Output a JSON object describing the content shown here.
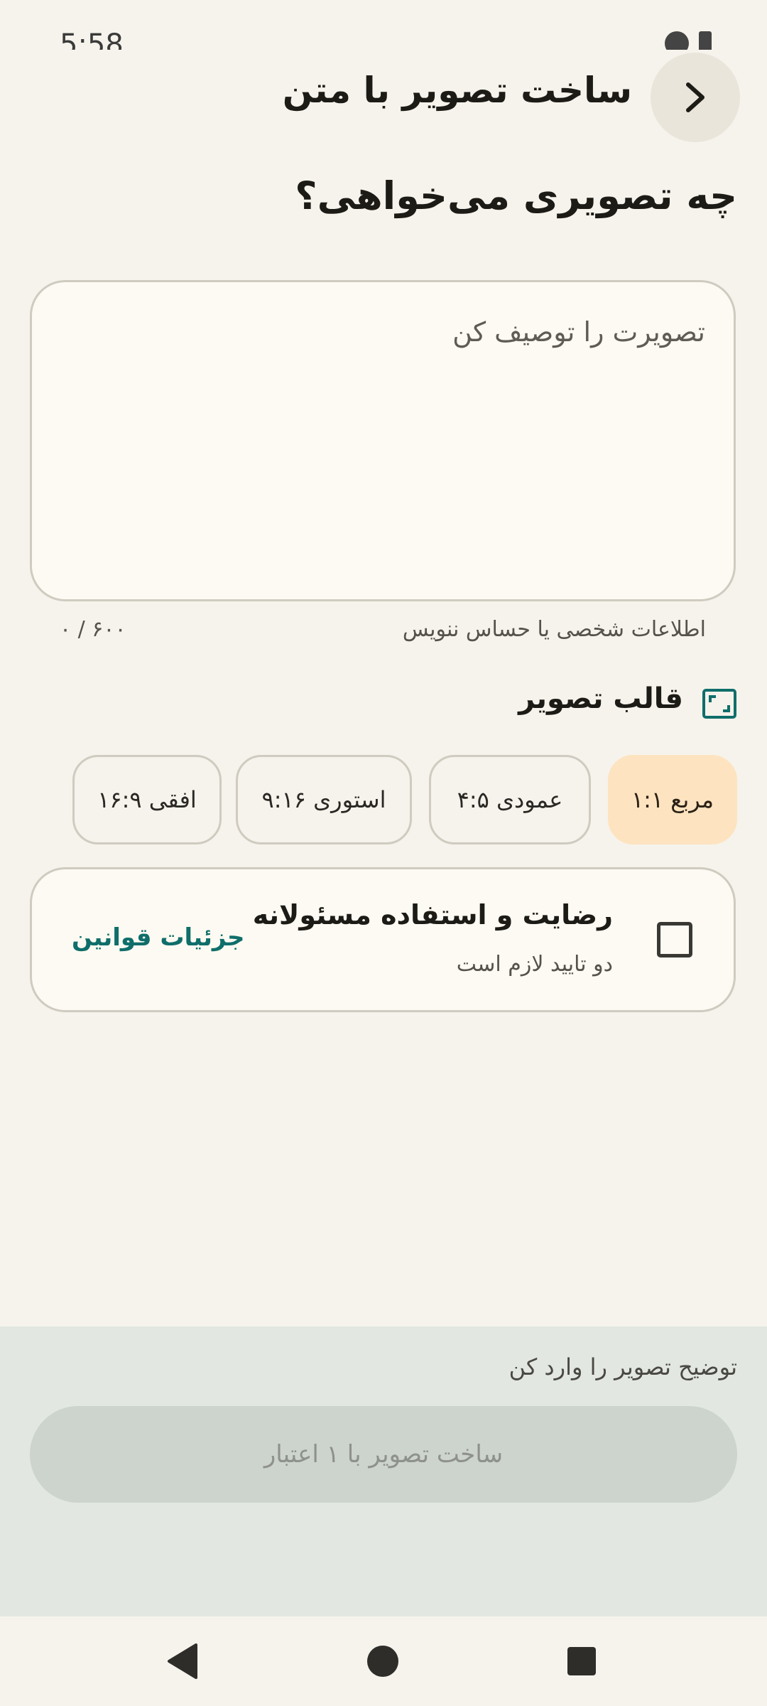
{
  "status_bar": {
    "time": "5:58"
  },
  "header": {
    "title": "ساخت تصویر با متن"
  },
  "question": "چه تصویری می‌خواهی؟",
  "prompt": {
    "placeholder": "تصویرت را توصیف کن",
    "value": "",
    "hint": "اطلاعات شخصی یا حساس ننویس",
    "counter": "۰ / ۶۰۰"
  },
  "format": {
    "title": "قالب تصویر",
    "chips": [
      {
        "label": "مربع ۱:۱",
        "selected": true
      },
      {
        "label": "عمودی ۴:۵",
        "selected": false
      },
      {
        "label": "استوری ۹:۱۶",
        "selected": false
      },
      {
        "label": "افقی ۱۶:۹",
        "selected": false
      }
    ]
  },
  "consent": {
    "title": "رضایت و استفاده مسئولانه",
    "subtitle": "دو تایید لازم است",
    "link": "جزئیات قوانین",
    "checked": false
  },
  "bottom": {
    "hint": "توضیح تصویر را وارد کن",
    "button_label": "ساخت تصویر با ۱ اعتبار"
  },
  "colors": {
    "background": "#f6f3ec",
    "accent": "#0f6e6a",
    "chip_selected": "#fde3bf",
    "panel": "#e2e7e1"
  }
}
